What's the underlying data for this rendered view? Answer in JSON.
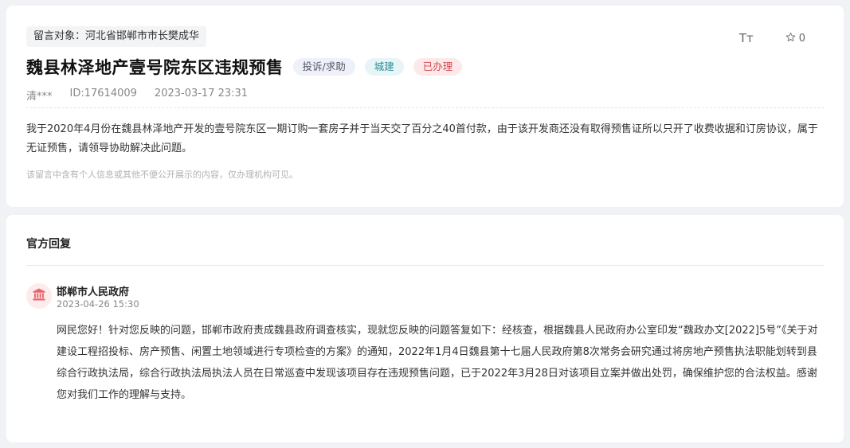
{
  "message": {
    "recipient": "留言对象：河北省邯郸市市长樊成华",
    "font_size_label": "Tт",
    "favorite_count": "0",
    "title": "魏县林泽地产壹号院东区违规预售",
    "tags": [
      "投诉/求助",
      "城建",
      "已办理"
    ],
    "author": "清***",
    "id_label": "ID:17614009",
    "datetime": "2023-03-17 23:31",
    "content": "我于2020年4月份在魏县林泽地产开发的壹号院东区一期订购一套房子并于当天交了百分之40首付款，由于该开发商还没有取得预售证所以只开了收费收据和订房协议，属于无证预售，请领导协助解决此问题。",
    "privacy_notice": "该留言中含有个人信息或其他不便公开展示的内容，仅办理机构可见。"
  },
  "official_reply": {
    "section_title": "官方回复",
    "org_name": "邯郸市人民政府",
    "date": "2023-04-26 15:30",
    "text": "网民您好！针对您反映的问题，邯郸市政府责成魏县政府调查核实，现就您反映的问题答复如下：经核查，根据魏县人民政府办公室印发“魏政办文[2022]5号”《关于对建设工程招投标、房产预售、闲置土地领域进行专项检查的方案》的通知，2022年1月4日魏县第十七届人民政府第8次常务会研究通过将房地产预售执法职能划转到县综合行政执法局，综合行政执法局执法人员在日常巡查中发现该项目存在违规预售问题，已于2022年3月28日对该项目立案并做出处罚，确保维护您的合法权益。感谢您对我们工作的理解与支持。"
  },
  "icons": {
    "font_size": "font-size-icon",
    "favorite": "star-icon",
    "avatar": "government-building-icon"
  },
  "colors": {
    "tag_complaint": "#556677",
    "tag_construction": "#2b8c99",
    "tag_handled": "#d6484f",
    "avatar_bg": "#fdecec",
    "avatar_icon": "#e8656a"
  }
}
